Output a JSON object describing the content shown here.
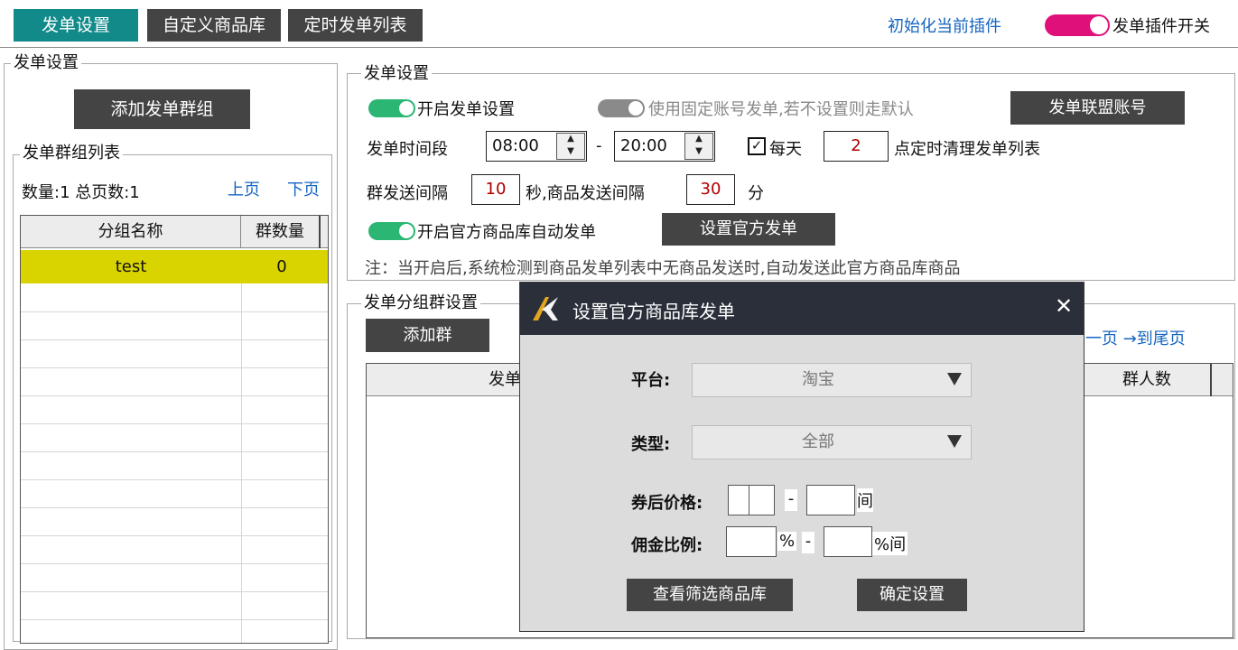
{
  "tabs": {
    "settings": "发单设置",
    "custom_library": "自定义商品库",
    "timed_list": "定时发单列表"
  },
  "header": {
    "init_link": "初始化当前插件",
    "plugin_switch_label": "发单插件开关"
  },
  "left_panel": {
    "title": "发单设置",
    "add_group_button": "添加发单群组",
    "group_list_title": "发单群组列表",
    "count_text": "数量:1 总页数:1",
    "prev_page": "上页",
    "next_page": "下页",
    "columns": [
      "分组名称",
      "群数量"
    ],
    "rows": [
      {
        "name": "test",
        "count": "0"
      }
    ]
  },
  "settings": {
    "title": "发单设置",
    "enable_label": "开启发单设置",
    "fixed_account_label": "使用固定账号发单,若不设置则走默认",
    "alliance_button": "发单联盟账号",
    "time_range_label": "发单时间段",
    "start_time": "08:00",
    "dash": "-",
    "end_time": "20:00",
    "daily_label": "每天",
    "clear_hour": "2",
    "clear_label": "点定时清理发单列表",
    "group_interval_label": "群发送间隔",
    "group_interval": "10",
    "goods_interval_label": "秒,商品发送间隔",
    "goods_interval": "30",
    "minute_label": "分",
    "official_label": "开启官方商品库自动发单",
    "official_button": "设置官方发单",
    "note": "注：当开启后,系统检测到商品发单列表中无商品发送时,自动发送此官方商品库商品"
  },
  "group_settings": {
    "title": "发单分组群设置",
    "add_group_button": "添加群",
    "page_links": "一页 →到尾页",
    "col_partial": "发单",
    "col_members": "群人数"
  },
  "dialog": {
    "title": "设置官方商品库发单",
    "close": "✕",
    "platform_label": "平台:",
    "platform_value": "淘宝",
    "type_label": "类型:",
    "type_value": "全部",
    "price_label": "券后价格:",
    "dash": "-",
    "between": "间",
    "commission_label": "佣金比例:",
    "percent": "%",
    "percent_between": "%间",
    "view_button": "查看筛选商品库",
    "confirm_button": "确定设置"
  },
  "colors": {
    "teal": "#128a8a",
    "dark_button": "#444444",
    "toggle_green": "#2bb673",
    "toggle_gray": "#8a8a8a",
    "plugin_switch": "#e0107a",
    "selected_row": "#d9d400",
    "dialog_title_bg": "#2b2f3a",
    "dialog_body_bg": "#dcdcdc"
  }
}
